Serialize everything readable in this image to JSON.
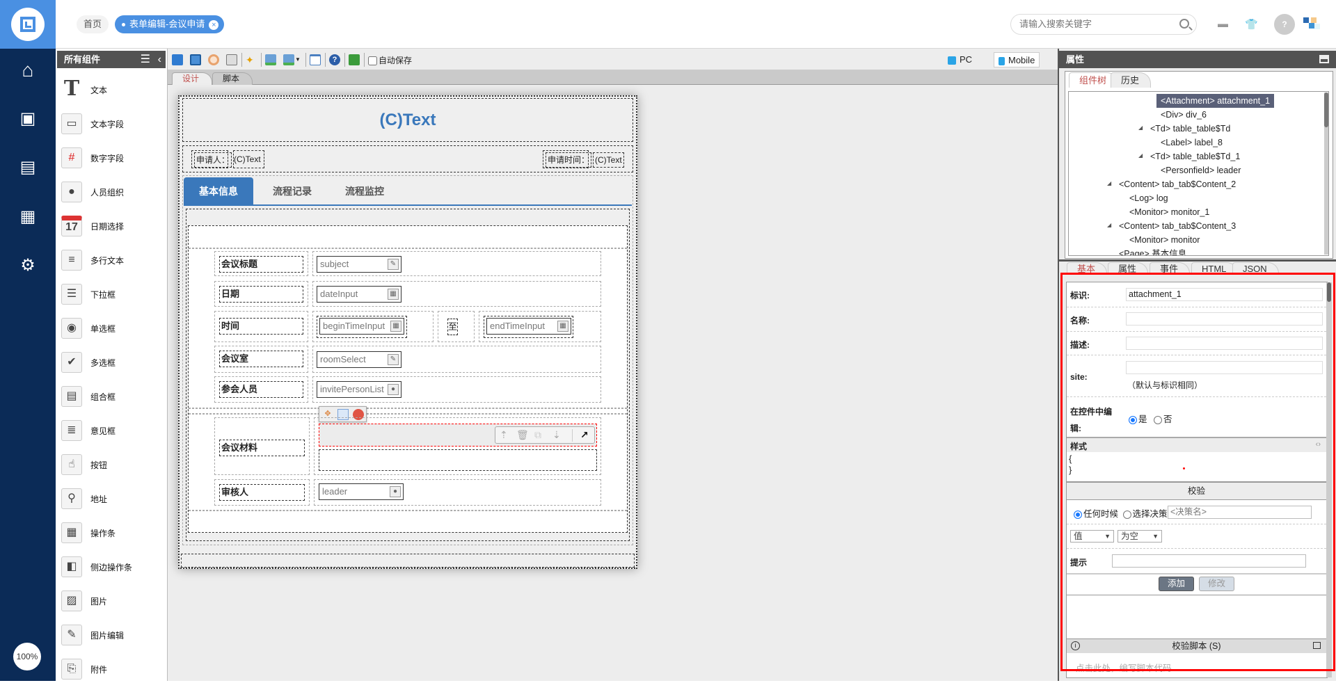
{
  "topbar": {
    "breadcrumb_home": "首页",
    "active_tab": "表单编辑-会议申请",
    "search_placeholder": "请输入搜索关键字",
    "icons": [
      "message-icon",
      "skin-icon",
      "avatar",
      "brand-logo"
    ]
  },
  "nav": {
    "items": [
      "home",
      "monitor-user",
      "form",
      "calendar",
      "user-settings"
    ],
    "zoom": "100%"
  },
  "components": {
    "title": "所有组件",
    "items": [
      "文本",
      "文本字段",
      "数字字段",
      "人员组织",
      "日期选择",
      "多行文本",
      "下拉框",
      "单选框",
      "多选框",
      "组合框",
      "意见框",
      "按钮",
      "地址",
      "操作条",
      "侧边操作条",
      "图片",
      "图片编辑",
      "附件"
    ]
  },
  "toolbar": {
    "autosave_label": "自动保存",
    "autosave_checked": false,
    "pc_label": "PC",
    "mobile_label": "Mobile",
    "active_device": "Mobile"
  },
  "canvas_tabs": {
    "design": "设计",
    "script": "脚本",
    "active": "design"
  },
  "form": {
    "title": "(C)Text",
    "applicant_label": "申请人：",
    "applicant_value": "(C)Text",
    "apply_time_label": "申请时间：",
    "apply_time_value": "(C)Text",
    "tabs": [
      "基本信息",
      "流程记录",
      "流程监控"
    ],
    "rows": {
      "subject_label": "会议标题",
      "subject": "subject",
      "date_label": "日期",
      "date": "dateInput",
      "time_label": "时间",
      "begin": "beginTimeInput",
      "to": "至",
      "end": "endTimeInput",
      "room_label": "会议室",
      "room": "roomSelect",
      "invite_label": "参会人员",
      "invite": "invitePersonList",
      "material_label": "会议材料",
      "reviewer_label": "审核人",
      "reviewer": "leader"
    }
  },
  "props": {
    "title": "属性",
    "tree_tabs": [
      "组件树",
      "历史"
    ],
    "tree": [
      {
        "text": "<Attachment> attachment_1",
        "level": 3,
        "selected": true
      },
      {
        "text": "<Div> div_6",
        "level": 3
      },
      {
        "text": "<Td> table_table$Td",
        "level": 2,
        "arrow": true
      },
      {
        "text": "<Label> label_8",
        "level": 3
      },
      {
        "text": "<Td> table_table$Td_1",
        "level": 2,
        "arrow": true
      },
      {
        "text": "<Personfield> leader",
        "level": 3
      },
      {
        "text": "<Content> tab_tab$Content_2",
        "level": 0,
        "arrow": true
      },
      {
        "text": "<Log> log",
        "level": 1
      },
      {
        "text": "<Monitor> monitor_1",
        "level": 1
      },
      {
        "text": "<Content> tab_tab$Content_3",
        "level": 0,
        "arrow": true
      },
      {
        "text": "<Monitor> monitor",
        "level": 1
      },
      {
        "text": "<Page> 基本信息",
        "level": 0
      }
    ],
    "tabs": [
      "基本",
      "属性",
      "事件",
      "HTML",
      "JSON"
    ],
    "id_label": "标识:",
    "id_value": "attachment_1",
    "name_label": "名称:",
    "name_value": "",
    "desc_label": "描述:",
    "desc_value": "",
    "site_label": "site:",
    "site_value": "",
    "site_note": "（默认与标识相同）",
    "edit_label": "在控件中编辑:",
    "edit_yes": "是",
    "edit_no": "否",
    "edit_value": "是",
    "style_label": "样式",
    "style_open": "{",
    "style_close": "}",
    "validate_title": "校验",
    "when_any": "任何时候",
    "when_decision": "选择决策",
    "decision_placeholder": "<决策名>",
    "field_select": "值",
    "cond_select": "为空",
    "tip_label": "提示",
    "tip_value": "",
    "add_btn": "添加",
    "modify_btn": "修改",
    "script_title": "校验脚本 (S)",
    "script_placeholder": "点击此处，编写脚本代码"
  },
  "colors": {
    "brand": "#4a90e2",
    "nav": "#0b2b57",
    "form_title": "#3a78bb",
    "highlight": "#ff0000"
  }
}
